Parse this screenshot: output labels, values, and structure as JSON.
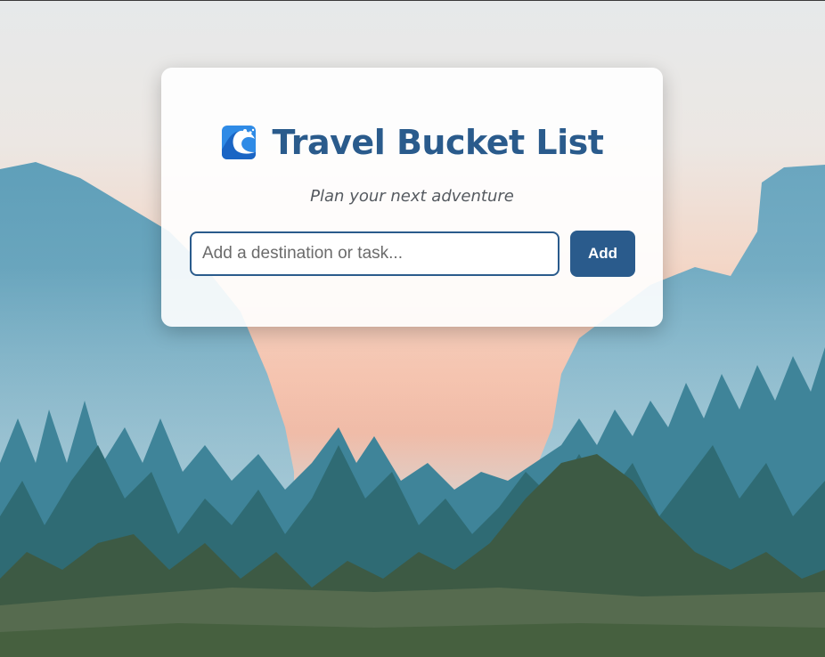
{
  "app": {
    "title": "Travel Bucket List",
    "subtitle": "Plan your next adventure",
    "title_icon": "water-wave-icon"
  },
  "form": {
    "input_value": "",
    "input_placeholder": "Add a destination or task...",
    "add_label": "Add"
  },
  "colors": {
    "accent": "#2a5b8c",
    "card_background": "#ffffff",
    "subtitle_text": "#555a60"
  },
  "background": {
    "scene": "misty mountain valley with pine forest at sunset"
  }
}
